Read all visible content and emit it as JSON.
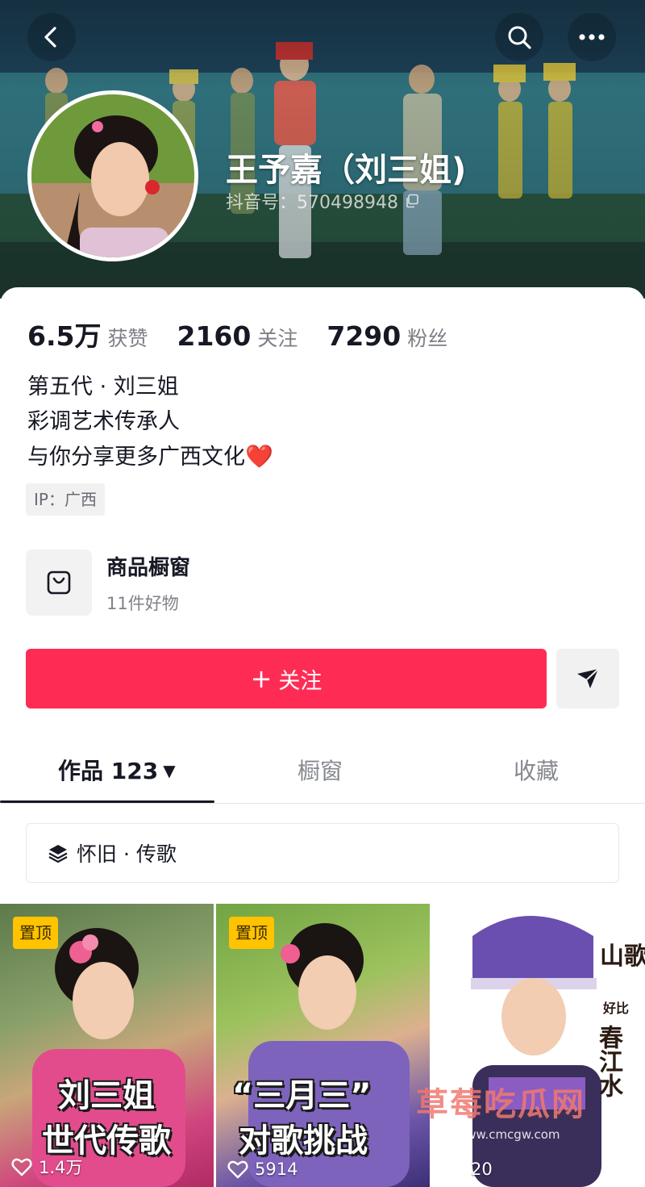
{
  "header": {
    "display_name": "王予嘉（刘三姐)",
    "douyin_id": "抖音号：570498948",
    "icons": [
      "back-icon",
      "search-icon",
      "more-icon",
      "copy-icon"
    ]
  },
  "stats": [
    {
      "value": "6.5万",
      "label": "获赞"
    },
    {
      "value": "2160",
      "label": "关注"
    },
    {
      "value": "7290",
      "label": "粉丝"
    }
  ],
  "bio": {
    "line1": "第五代 · 刘三姐",
    "line2": "彩调艺术传承人",
    "line3": "与你分享更多广西文化",
    "heart": "❤️"
  },
  "ip_tag": "IP：广西",
  "shop": {
    "title": "商品橱窗",
    "subtitle": "11件好物",
    "icon": "bag-icon"
  },
  "actions": {
    "follow_plus": "+",
    "follow_label": "关注",
    "share_icon": "send-icon"
  },
  "tabs": {
    "works": "作品 123",
    "window": "橱窗",
    "favorites": "收藏"
  },
  "collection": {
    "label": "怀旧 · 传歌",
    "icon": "layers-icon"
  },
  "videos": [
    {
      "pinned": "置顶",
      "line1": "刘三姐",
      "line2": "世代传歌",
      "likes": "1.4万"
    },
    {
      "pinned": "置顶",
      "line1": "“三月三”",
      "line2": "对歌挑战",
      "likes": "5914"
    },
    {
      "side_text": "山歌",
      "small_text": "好比",
      "side_text2": "春江水",
      "likes": "20"
    }
  ],
  "watermark": {
    "text": "草莓吃瓜网",
    "url": "www.cmcgw.com"
  },
  "colors": {
    "accent": "#fe2c55",
    "pin": "#ffc300",
    "text": "#161823",
    "secondary": "#7d7f86"
  }
}
